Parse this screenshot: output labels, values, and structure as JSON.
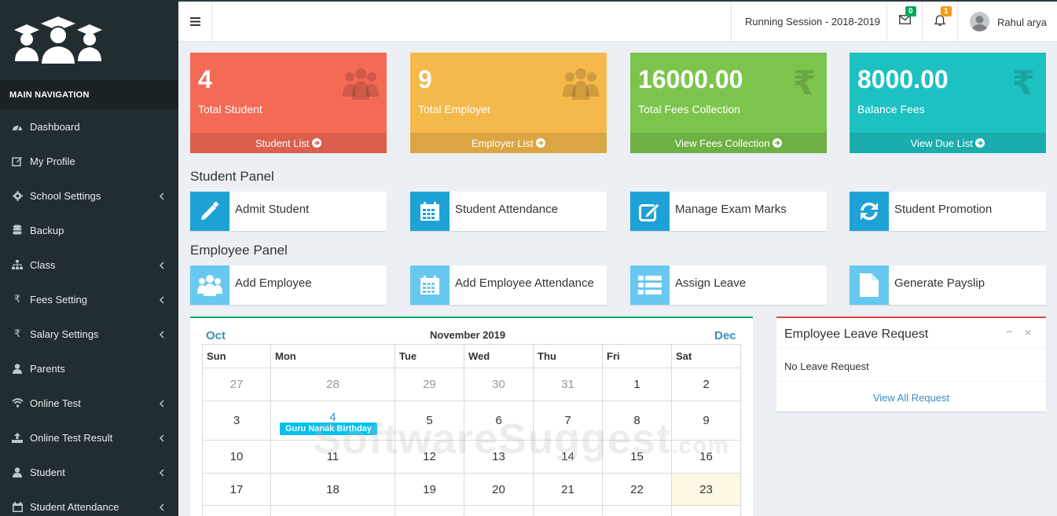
{
  "sidebar": {
    "nav_header": "MAIN NAVIGATION",
    "items": [
      {
        "label": "Dashboard",
        "icon": "dashboard-icon"
      },
      {
        "label": "My Profile",
        "icon": "edit-icon"
      },
      {
        "label": "School Settings",
        "icon": "gear-icon"
      },
      {
        "label": "Backup",
        "icon": "database-icon"
      },
      {
        "label": "Class",
        "icon": "sitemap-icon"
      },
      {
        "label": "Fees Setting",
        "icon": "rupee-icon"
      },
      {
        "label": "Salary Settings",
        "icon": "rupee-icon"
      },
      {
        "label": "Parents",
        "icon": "user-icon"
      },
      {
        "label": "Online Test",
        "icon": "wifi-icon"
      },
      {
        "label": "Online Test Result",
        "icon": "upload-icon"
      },
      {
        "label": "Student",
        "icon": "user-icon"
      },
      {
        "label": "Student Attendance",
        "icon": "calendar-icon"
      }
    ]
  },
  "topbar": {
    "session": "Running Session - 2018-2019",
    "messages_count": "0",
    "notifications_count": "1",
    "user_name": "Rahul arya"
  },
  "stats": [
    {
      "value": "4",
      "label": "Total Student",
      "link": "Student List",
      "color": "#f46a55",
      "foot_color": "#db5f4c"
    },
    {
      "value": "9",
      "label": "Total Employer",
      "link": "Employer List",
      "color": "#f5b84b",
      "foot_color": "#dca543"
    },
    {
      "value": "16000.00",
      "label": "Total Fees Collection",
      "link": "View Fees Collection",
      "color": "#7cc44c",
      "foot_color": "#6fb044"
    },
    {
      "value": "8000.00",
      "label": "Balance Fees",
      "link": "View Due List",
      "color": "#1ec1c1",
      "foot_color": "#1badad"
    }
  ],
  "student_panel": {
    "title": "Student Panel",
    "actions": [
      "Admit Student",
      "Student Attendance",
      "Manage Exam Marks",
      "Student Promotion"
    ]
  },
  "employee_panel": {
    "title": "Employee Panel",
    "actions": [
      "Add Employee",
      "Add Employee Attendance",
      "Assign Leave",
      "Generate Payslip"
    ]
  },
  "calendar": {
    "prev": "Oct",
    "next": "Dec",
    "month": "November 2019",
    "days": [
      "Sun",
      "Mon",
      "Tue",
      "Wed",
      "Thu",
      "Fri",
      "Sat"
    ],
    "weeks": [
      [
        "27",
        "28",
        "29",
        "30",
        "31",
        "1",
        "2"
      ],
      [
        "3",
        "4",
        "5",
        "6",
        "7",
        "8",
        "9"
      ],
      [
        "10",
        "11",
        "12",
        "13",
        "14",
        "15",
        "16"
      ],
      [
        "17",
        "18",
        "19",
        "20",
        "21",
        "22",
        "23"
      ]
    ],
    "event": "Guru Nanak Birthday"
  },
  "leave": {
    "title": "Employee Leave Request",
    "minimize": "−",
    "close": "×",
    "empty": "No Leave Request",
    "link": "View All Request"
  },
  "watermark": {
    "main": "SoftwareSuggest",
    "suffix": ".com"
  }
}
